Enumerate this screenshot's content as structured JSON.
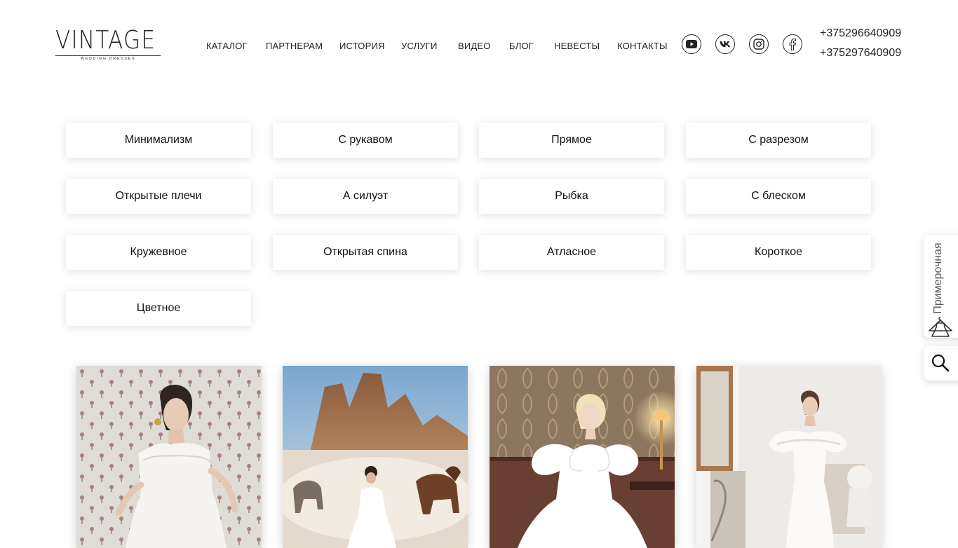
{
  "logo": {
    "main": "VINTAGE",
    "sub": "WEDDING DRESSES"
  },
  "nav": [
    "КАТАЛОГ",
    "ПАРТНЕРАМ",
    "ИСТОРИЯ",
    "УСЛУГИ",
    "ВИДЕО",
    "БЛОГ",
    "НЕВЕСТЫ",
    "КОНТАКТЫ"
  ],
  "social": [
    "youtube-icon",
    "vk-icon",
    "instagram-icon",
    "facebook-icon"
  ],
  "phones": [
    "+375296640909",
    "+375297640909"
  ],
  "filters": [
    "Минимализм",
    "С рукавом",
    "Прямое",
    "С разрезом",
    "Открытые плечи",
    "А силуэт",
    "Рыбка",
    "С блеском",
    "Кружевное",
    "Открытая спина",
    "Атласное",
    "Короткое",
    "Цветное"
  ],
  "side": {
    "fitting_label": "Примерочная",
    "fitting_icon": "dress-hanger-icon",
    "search_icon": "search-icon"
  },
  "colors": {
    "text": "#111111",
    "background": "#ffffff",
    "muted": "#555555"
  }
}
